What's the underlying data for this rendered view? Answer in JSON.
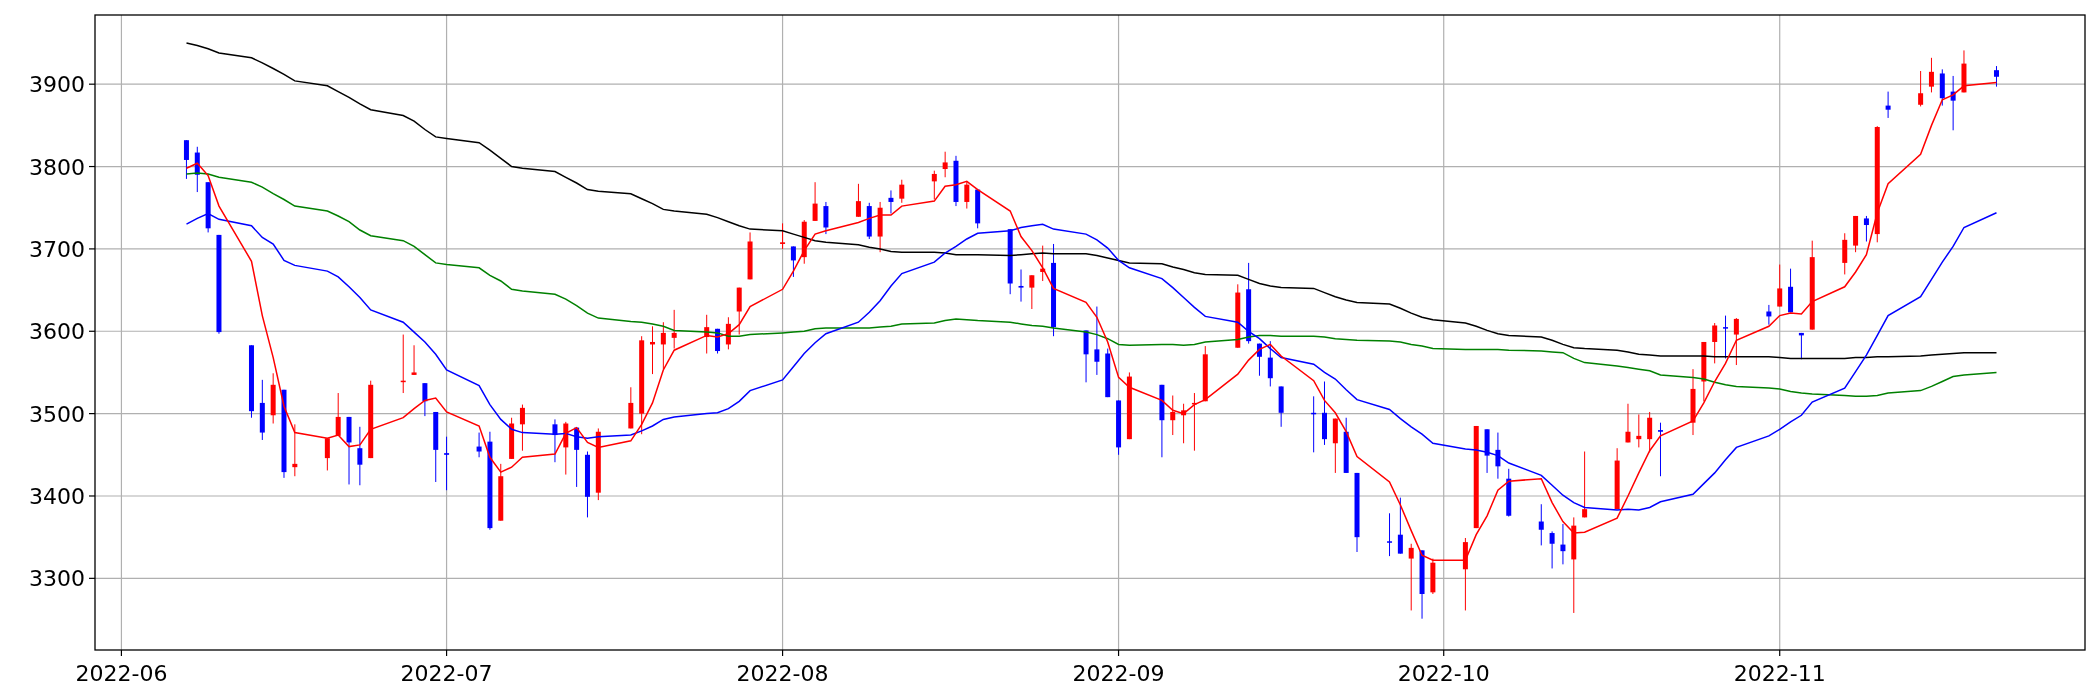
{
  "chart": {
    "chart_data": {
      "type": "candlestick",
      "x": [
        "2022-06-07",
        "2022-06-08",
        "2022-06-09",
        "2022-06-10",
        "2022-06-13",
        "2022-06-14",
        "2022-06-15",
        "2022-06-16",
        "2022-06-17",
        "2022-06-20",
        "2022-06-21",
        "2022-06-22",
        "2022-06-23",
        "2022-06-24",
        "2022-06-27",
        "2022-06-28",
        "2022-06-29",
        "2022-06-30",
        "2022-07-01",
        "2022-07-04",
        "2022-07-05",
        "2022-07-06",
        "2022-07-07",
        "2022-07-08",
        "2022-07-11",
        "2022-07-12",
        "2022-07-13",
        "2022-07-14",
        "2022-07-15",
        "2022-07-18",
        "2022-07-19",
        "2022-07-20",
        "2022-07-21",
        "2022-07-22",
        "2022-07-25",
        "2022-07-26",
        "2022-07-27",
        "2022-07-28",
        "2022-07-29",
        "2022-08-01",
        "2022-08-02",
        "2022-08-03",
        "2022-08-04",
        "2022-08-05",
        "2022-08-08",
        "2022-08-09",
        "2022-08-10",
        "2022-08-11",
        "2022-08-12",
        "2022-08-15",
        "2022-08-16",
        "2022-08-17",
        "2022-08-18",
        "2022-08-19",
        "2022-08-22",
        "2022-08-23",
        "2022-08-24",
        "2022-08-25",
        "2022-08-26",
        "2022-08-29",
        "2022-08-30",
        "2022-08-31",
        "2022-09-01",
        "2022-09-02",
        "2022-09-05",
        "2022-09-06",
        "2022-09-07",
        "2022-09-08",
        "2022-09-09",
        "2022-09-12",
        "2022-09-13",
        "2022-09-14",
        "2022-09-15",
        "2022-09-16",
        "2022-09-19",
        "2022-09-20",
        "2022-09-21",
        "2022-09-22",
        "2022-09-23",
        "2022-09-26",
        "2022-09-27",
        "2022-09-28",
        "2022-09-29",
        "2022-09-30",
        "2022-10-03",
        "2022-10-04",
        "2022-10-05",
        "2022-10-06",
        "2022-10-07",
        "2022-10-10",
        "2022-10-11",
        "2022-10-12",
        "2022-10-13",
        "2022-10-14",
        "2022-10-17",
        "2022-10-18",
        "2022-10-19",
        "2022-10-20",
        "2022-10-21",
        "2022-10-24",
        "2022-10-25",
        "2022-10-26",
        "2022-10-27",
        "2022-10-28",
        "2022-10-31",
        "2022-11-01",
        "2022-11-02",
        "2022-11-03",
        "2022-11-04",
        "2022-11-07",
        "2022-11-08",
        "2022-11-09",
        "2022-11-10",
        "2022-11-11",
        "2022-11-14",
        "2022-11-15",
        "2022-11-16",
        "2022-11-17",
        "2022-11-18",
        "2022-11-21"
      ],
      "ohlc": [
        [
          3832,
          3832,
          3785,
          3808
        ],
        [
          3817,
          3824,
          3769,
          3790
        ],
        [
          3781,
          3781,
          3720,
          3725
        ],
        [
          3717,
          3717,
          3597,
          3599
        ],
        [
          3583,
          3583,
          3495,
          3503
        ],
        [
          3513,
          3541,
          3468,
          3477
        ],
        [
          3498,
          3549,
          3488,
          3535
        ],
        [
          3529,
          3529,
          3422,
          3429
        ],
        [
          3435,
          3487,
          3424,
          3439
        ],
        [
          3446,
          3470,
          3431,
          3470
        ],
        [
          3473,
          3525,
          3473,
          3496
        ],
        [
          3496,
          3496,
          3414,
          3465
        ],
        [
          3458,
          3484,
          3413,
          3438
        ],
        [
          3446,
          3540,
          3446,
          3535
        ],
        [
          3539,
          3596,
          3525,
          3540
        ],
        [
          3547,
          3583,
          3547,
          3550
        ],
        [
          3537,
          3537,
          3497,
          3515
        ],
        [
          3502,
          3502,
          3417,
          3456
        ],
        [
          3452,
          3472,
          3407,
          3450
        ],
        [
          3460,
          3477,
          3447,
          3454
        ],
        [
          3466,
          3478,
          3359,
          3361
        ],
        [
          3370,
          3439,
          3370,
          3424
        ],
        [
          3445,
          3495,
          3445,
          3488
        ],
        [
          3487,
          3511,
          3455,
          3507
        ],
        [
          3487,
          3493,
          3441,
          3474
        ],
        [
          3459,
          3490,
          3426,
          3488
        ],
        [
          3483,
          3483,
          3411,
          3456
        ],
        [
          3450,
          3454,
          3374,
          3399
        ],
        [
          3404,
          3482,
          3395,
          3478
        ],
        [
          3482,
          3532,
          3482,
          3513
        ],
        [
          3500,
          3594,
          3475,
          3589
        ],
        [
          3584,
          3606,
          3548,
          3587
        ],
        [
          3584,
          3611,
          3554,
          3598
        ],
        [
          3592,
          3626,
          3579,
          3598
        ],
        [
          3593,
          3620,
          3573,
          3605
        ],
        [
          3603,
          3603,
          3573,
          3576
        ],
        [
          3584,
          3617,
          3578,
          3609
        ],
        [
          3624,
          3653,
          3596,
          3653
        ],
        [
          3663,
          3720,
          3663,
          3709
        ],
        [
          3706,
          3731,
          3700,
          3708
        ],
        [
          3703,
          3703,
          3666,
          3686
        ],
        [
          3690,
          3735,
          3682,
          3733
        ],
        [
          3734,
          3781,
          3734,
          3755
        ],
        [
          3752,
          3757,
          3718,
          3726
        ],
        [
          3739,
          3779,
          3739,
          3758
        ],
        [
          3752,
          3756,
          3712,
          3715
        ],
        [
          3715,
          3757,
          3696,
          3750
        ],
        [
          3762,
          3771,
          3743,
          3757
        ],
        [
          3761,
          3784,
          3756,
          3778
        ],
        [
          3782,
          3795,
          3760,
          3791
        ],
        [
          3797,
          3818,
          3787,
          3805
        ],
        [
          3807,
          3813,
          3752,
          3757
        ],
        [
          3757,
          3782,
          3749,
          3778
        ],
        [
          3772,
          3772,
          3725,
          3731
        ],
        [
          3724,
          3724,
          3645,
          3658
        ],
        [
          3655,
          3675,
          3636,
          3653
        ],
        [
          3653,
          3668,
          3627,
          3668
        ],
        [
          3672,
          3704,
          3661,
          3676
        ],
        [
          3683,
          3706,
          3594,
          3605
        ],
        [
          3601,
          3601,
          3538,
          3572
        ],
        [
          3578,
          3630,
          3547,
          3563
        ],
        [
          3573,
          3579,
          3520,
          3520
        ],
        [
          3516,
          3516,
          3450,
          3459
        ],
        [
          3469,
          3550,
          3469,
          3545
        ],
        [
          3535,
          3535,
          3447,
          3492
        ],
        [
          3492,
          3522,
          3474,
          3502
        ],
        [
          3498,
          3512,
          3464,
          3504
        ],
        [
          3512,
          3525,
          3455,
          3513
        ],
        [
          3515,
          3582,
          3515,
          3572
        ],
        [
          3580,
          3657,
          3580,
          3647
        ],
        [
          3651,
          3683,
          3585,
          3588
        ],
        [
          3585,
          3585,
          3546,
          3569
        ],
        [
          3568,
          3588,
          3533,
          3543
        ],
        [
          3533,
          3533,
          3484,
          3501
        ],
        [
          3501,
          3521,
          3453,
          3500
        ],
        [
          3501,
          3539,
          3462,
          3469
        ],
        [
          3464,
          3494,
          3428,
          3494
        ],
        [
          3478,
          3495,
          3428,
          3428
        ],
        [
          3428,
          3428,
          3332,
          3350
        ],
        [
          3345,
          3379,
          3327,
          3344
        ],
        [
          3353,
          3398,
          3330,
          3330
        ],
        [
          3324,
          3342,
          3261,
          3337
        ],
        [
          3334,
          3334,
          3251,
          3281
        ],
        [
          3283,
          3324,
          3281,
          3319
        ],
        [
          3311,
          3349,
          3261,
          3344
        ],
        [
          3361,
          3485,
          3361,
          3485
        ],
        [
          3481,
          3481,
          3428,
          3449
        ],
        [
          3456,
          3477,
          3421,
          3436
        ],
        [
          3421,
          3433,
          3375,
          3376
        ],
        [
          3369,
          3390,
          3340,
          3359
        ],
        [
          3355,
          3357,
          3312,
          3342
        ],
        [
          3341,
          3366,
          3317,
          3333
        ],
        [
          3323,
          3374,
          3258,
          3364
        ],
        [
          3374,
          3454,
          3374,
          3384
        ],
        [
          3384,
          3458,
          3384,
          3443
        ],
        [
          3465,
          3512,
          3465,
          3478
        ],
        [
          3469,
          3499,
          3459,
          3473
        ],
        [
          3469,
          3502,
          3453,
          3495
        ],
        [
          3480,
          3489,
          3424,
          3478
        ],
        [
          3489,
          3554,
          3474,
          3530
        ],
        [
          3539,
          3587,
          3515,
          3587
        ],
        [
          3587,
          3610,
          3561,
          3607
        ],
        [
          3605,
          3619,
          3567,
          3604
        ],
        [
          3596,
          3616,
          3559,
          3615
        ],
        [
          3624,
          3632,
          3608,
          3618
        ],
        [
          3630,
          3681,
          3630,
          3652
        ],
        [
          3654,
          3676,
          3623,
          3623
        ],
        [
          3598,
          3598,
          3566,
          3595
        ],
        [
          3602,
          3710,
          3602,
          3690
        ],
        [
          3683,
          3719,
          3669,
          3711
        ],
        [
          3704,
          3740,
          3696,
          3740
        ],
        [
          3737,
          3740,
          3709,
          3729
        ],
        [
          3718,
          3849,
          3708,
          3848
        ],
        [
          3874,
          3891,
          3859,
          3869
        ],
        [
          3875,
          3916,
          3873,
          3889
        ],
        [
          3897,
          3932,
          3890,
          3915
        ],
        [
          3913,
          3918,
          3874,
          3883
        ],
        [
          3891,
          3910,
          3844,
          3880
        ],
        [
          3890,
          3941,
          3890,
          3925
        ],
        [
          3917,
          3922,
          3897,
          3909
        ]
      ],
      "xlim": [
        "2022-05-29T13:30:00Z",
        "2022-11-29T04:00:00Z"
      ],
      "ylim": [
        3213,
        3984
      ],
      "xticks": [
        {
          "value": "2022-06-01",
          "label": "2022-06"
        },
        {
          "value": "2022-07-01",
          "label": "2022-07"
        },
        {
          "value": "2022-08-01",
          "label": "2022-08"
        },
        {
          "value": "2022-09-01",
          "label": "2022-09"
        },
        {
          "value": "2022-10-01",
          "label": "2022-10"
        },
        {
          "value": "2022-11-01",
          "label": "2022-11"
        }
      ],
      "yticks": [
        3300,
        3400,
        3500,
        3600,
        3700,
        3800,
        3900
      ],
      "grid": true,
      "series": [
        {
          "type": "line",
          "color": "#000000",
          "values": [
            3950,
            3947,
            3943,
            3938,
            3932,
            3926,
            3919,
            3912,
            3904,
            3898,
            3891,
            3884,
            3876,
            3869,
            3862,
            3855,
            3845,
            3836,
            3834,
            3829,
            3820,
            3810,
            3800,
            3798,
            3794,
            3787,
            3780,
            3772,
            3770,
            3767,
            3761,
            3755,
            3748,
            3746,
            3742,
            3738,
            3733,
            3728,
            3724,
            3722,
            3718,
            3714,
            3710,
            3708,
            3705,
            3702,
            3700,
            3697,
            3696,
            3696,
            3695,
            3693,
            3693,
            3693,
            3692,
            3693,
            3694,
            3695,
            3694,
            3694,
            3692,
            3689,
            3686,
            3683,
            3682,
            3678,
            3675,
            3671,
            3669,
            3668,
            3663,
            3658,
            3655,
            3653,
            3652,
            3647,
            3642,
            3638,
            3635,
            3633,
            3628,
            3622,
            3617,
            3614,
            3610,
            3606,
            3601,
            3597,
            3595,
            3593,
            3589,
            3584,
            3580,
            3579,
            3577,
            3575,
            3572,
            3571,
            3570,
            3570,
            3570,
            3569,
            3569,
            3569,
            3569,
            3568,
            3567,
            3567,
            3567,
            3567,
            3568,
            3568,
            3569,
            3569,
            3570,
            3571,
            3572,
            3573,
            3574,
            3574
          ]
        },
        {
          "type": "line",
          "color": "#008000",
          "values": [
            3791,
            3792,
            3791,
            3787,
            3781,
            3775,
            3767,
            3760,
            3752,
            3746,
            3740,
            3733,
            3723,
            3716,
            3710,
            3703,
            3693,
            3683,
            3681,
            3677,
            3668,
            3661,
            3651,
            3649,
            3645,
            3639,
            3631,
            3622,
            3616,
            3612,
            3611,
            3609,
            3606,
            3601,
            3599,
            3598,
            3594,
            3594,
            3596,
            3598,
            3599,
            3600,
            3603,
            3604,
            3604,
            3604,
            3605,
            3606,
            3609,
            3610,
            3613,
            3615,
            3614,
            3613,
            3611,
            3609,
            3607,
            3606,
            3604,
            3599,
            3596,
            3591,
            3584,
            3583,
            3584,
            3584,
            3583,
            3584,
            3587,
            3590,
            3593,
            3595,
            3595,
            3594,
            3594,
            3593,
            3591,
            3590,
            3589,
            3588,
            3587,
            3584,
            3582,
            3579,
            3578,
            3578,
            3578,
            3578,
            3577,
            3576,
            3575,
            3574,
            3567,
            3562,
            3558,
            3556,
            3554,
            3552,
            3547,
            3544,
            3542,
            3538,
            3535,
            3533,
            3531,
            3530,
            3527,
            3525,
            3524,
            3522,
            3521,
            3521,
            3522,
            3525,
            3528,
            3533,
            3539,
            3545,
            3547,
            3550
          ]
        },
        {
          "type": "line",
          "color": "#0000ff",
          "values": [
            3730,
            3737,
            3743,
            3736,
            3728,
            3714,
            3706,
            3686,
            3680,
            3673,
            3666,
            3654,
            3641,
            3626,
            3611,
            3599,
            3587,
            3572,
            3553,
            3534,
            3511,
            3493,
            3481,
            3477,
            3475,
            3476,
            3472,
            3470,
            3472,
            3474,
            3479,
            3485,
            3493,
            3496,
            3500,
            3501,
            3506,
            3515,
            3528,
            3541,
            3557,
            3573,
            3586,
            3597,
            3611,
            3623,
            3637,
            3655,
            3670,
            3684,
            3695,
            3703,
            3712,
            3719,
            3722,
            3726,
            3728,
            3730,
            3724,
            3718,
            3711,
            3701,
            3686,
            3677,
            3664,
            3653,
            3641,
            3629,
            3618,
            3611,
            3600,
            3591,
            3579,
            3568,
            3560,
            3550,
            3542,
            3529,
            3517,
            3505,
            3494,
            3484,
            3475,
            3464,
            3457,
            3456,
            3453,
            3449,
            3440,
            3425,
            3413,
            3401,
            3392,
            3386,
            3383,
            3384,
            3383,
            3386,
            3393,
            3402,
            3415,
            3428,
            3444,
            3459,
            3473,
            3481,
            3490,
            3498,
            3514,
            3531,
            3551,
            3571,
            3595,
            3619,
            3642,
            3663,
            3684,
            3703,
            3726,
            3744
          ]
        },
        {
          "type": "line",
          "color": "#ff0000",
          "values": [
            3798,
            3804,
            3789,
            3752,
            3685,
            3619,
            3568,
            3509,
            3477,
            3470,
            3474,
            3460,
            3462,
            3481,
            3495,
            3506,
            3516,
            3519,
            3502,
            3485,
            3447,
            3429,
            3435,
            3447,
            3451,
            3476,
            3483,
            3465,
            3459,
            3467,
            3487,
            3513,
            3553,
            3577,
            3595,
            3593,
            3597,
            3608,
            3630,
            3651,
            3673,
            3698,
            3718,
            3722,
            3732,
            3737,
            3741,
            3741,
            3752,
            3758,
            3776,
            3778,
            3782,
            3772,
            3746,
            3715,
            3698,
            3677,
            3652,
            3635,
            3617,
            3587,
            3544,
            3532,
            3516,
            3504,
            3500,
            3511,
            3517,
            3548,
            3565,
            3578,
            3584,
            3570,
            3540,
            3516,
            3501,
            3478,
            3448,
            3417,
            3389,
            3358,
            3328,
            3322,
            3322,
            3353,
            3376,
            3407,
            3418,
            3421,
            3392,
            3369,
            3355,
            3356,
            3373,
            3400,
            3428,
            3455,
            3473,
            3491,
            3513,
            3539,
            3561,
            3589,
            3606,
            3619,
            3622,
            3621,
            3636,
            3654,
            3672,
            3693,
            3744,
            3779,
            3815,
            3850,
            3881,
            3887,
            3898,
            3902
          ]
        }
      ]
    }
  }
}
